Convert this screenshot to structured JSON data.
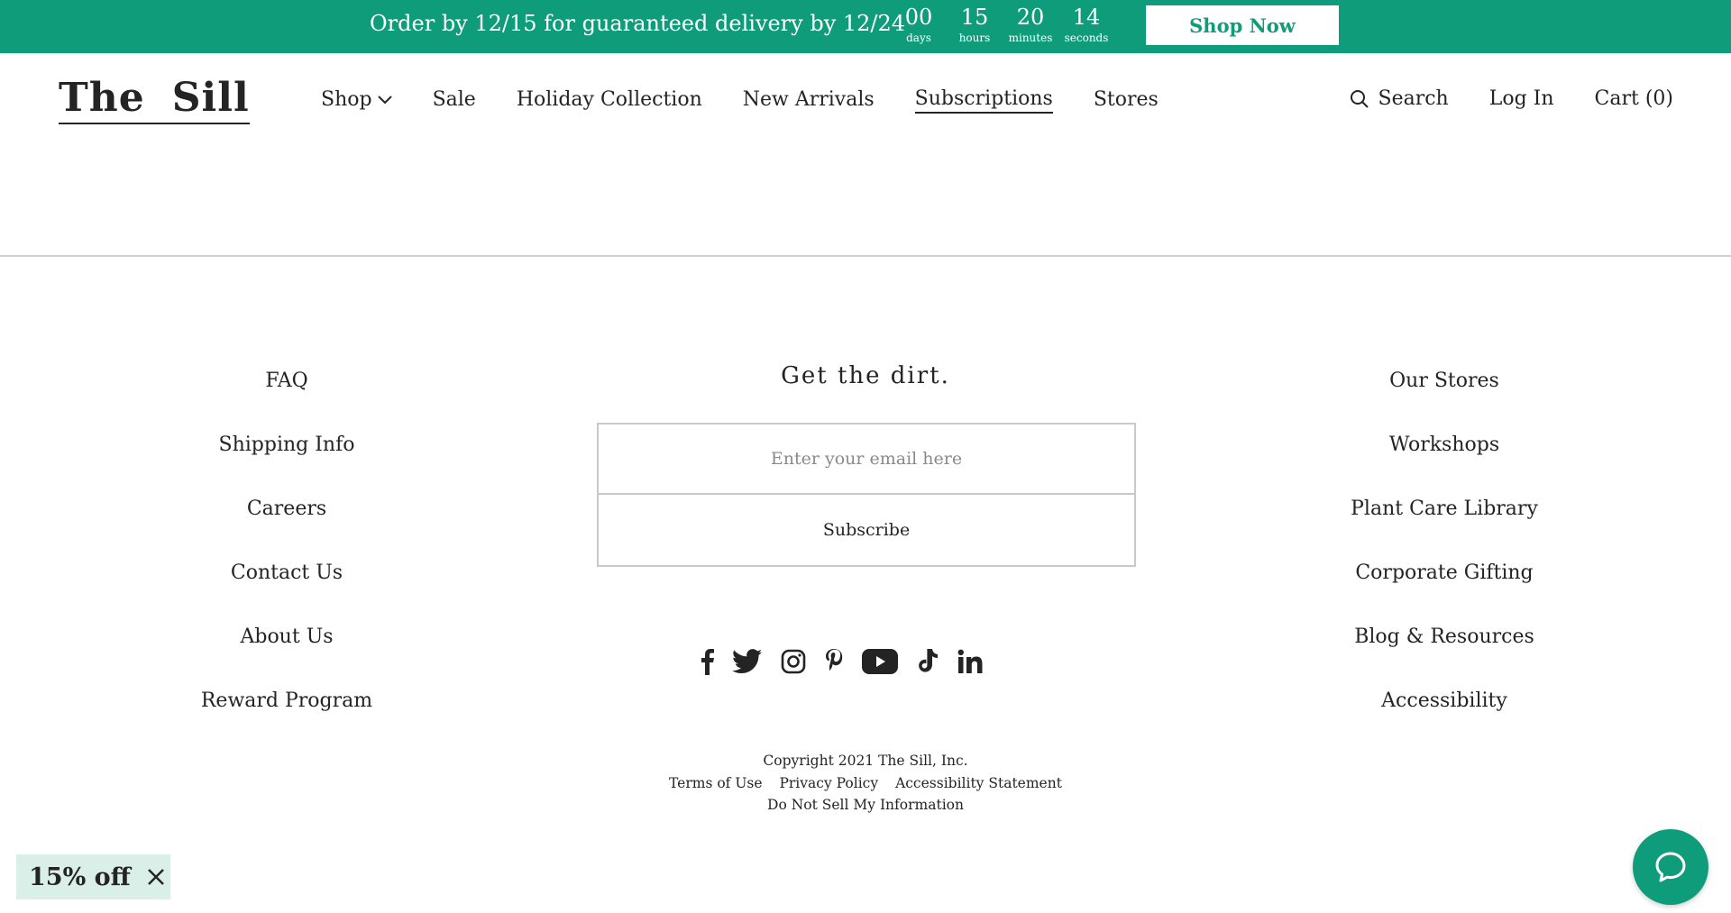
{
  "promo": {
    "message": "Order by 12/15 for guaranteed delivery by 12/24",
    "countdown": [
      {
        "value": "00",
        "label": "days"
      },
      {
        "value": "15",
        "label": "hours"
      },
      {
        "value": "20",
        "label": "minutes"
      },
      {
        "value": "14",
        "label": "seconds"
      }
    ],
    "cta": "Shop Now"
  },
  "header": {
    "logo_word1": "The",
    "logo_word2": "Sill",
    "nav": [
      "Shop",
      "Sale",
      "Holiday Collection",
      "New Arrivals",
      "Subscriptions",
      "Stores"
    ],
    "active_nav": "Subscriptions",
    "search": "Search",
    "login": "Log In",
    "cart": "Cart (0)"
  },
  "footer": {
    "left_links": [
      "FAQ",
      "Shipping Info",
      "Careers",
      "Contact Us",
      "About Us",
      "Reward Program"
    ],
    "right_links": [
      "Our Stores",
      "Workshops",
      "Plant Care Library",
      "Corporate Gifting",
      "Blog & Resources",
      "Accessibility"
    ],
    "newsletter": {
      "title": "Get the dirt.",
      "placeholder": "Enter your email here",
      "button": "Subscribe"
    },
    "socials": [
      "facebook-icon",
      "twitter-icon",
      "instagram-icon",
      "pinterest-icon",
      "youtube-icon",
      "tiktok-icon",
      "linkedin-icon"
    ],
    "copyright": "Copyright 2021 The Sill, Inc.",
    "legal": [
      "Terms of Use",
      "Privacy Policy",
      "Accessibility Statement"
    ],
    "do_not_sell": "Do Not Sell My Information"
  },
  "discount_badge": "15% off",
  "colors": {
    "brand_green": "#0e9c7b",
    "text": "#242424",
    "badge_bg": "#d9efe8"
  }
}
